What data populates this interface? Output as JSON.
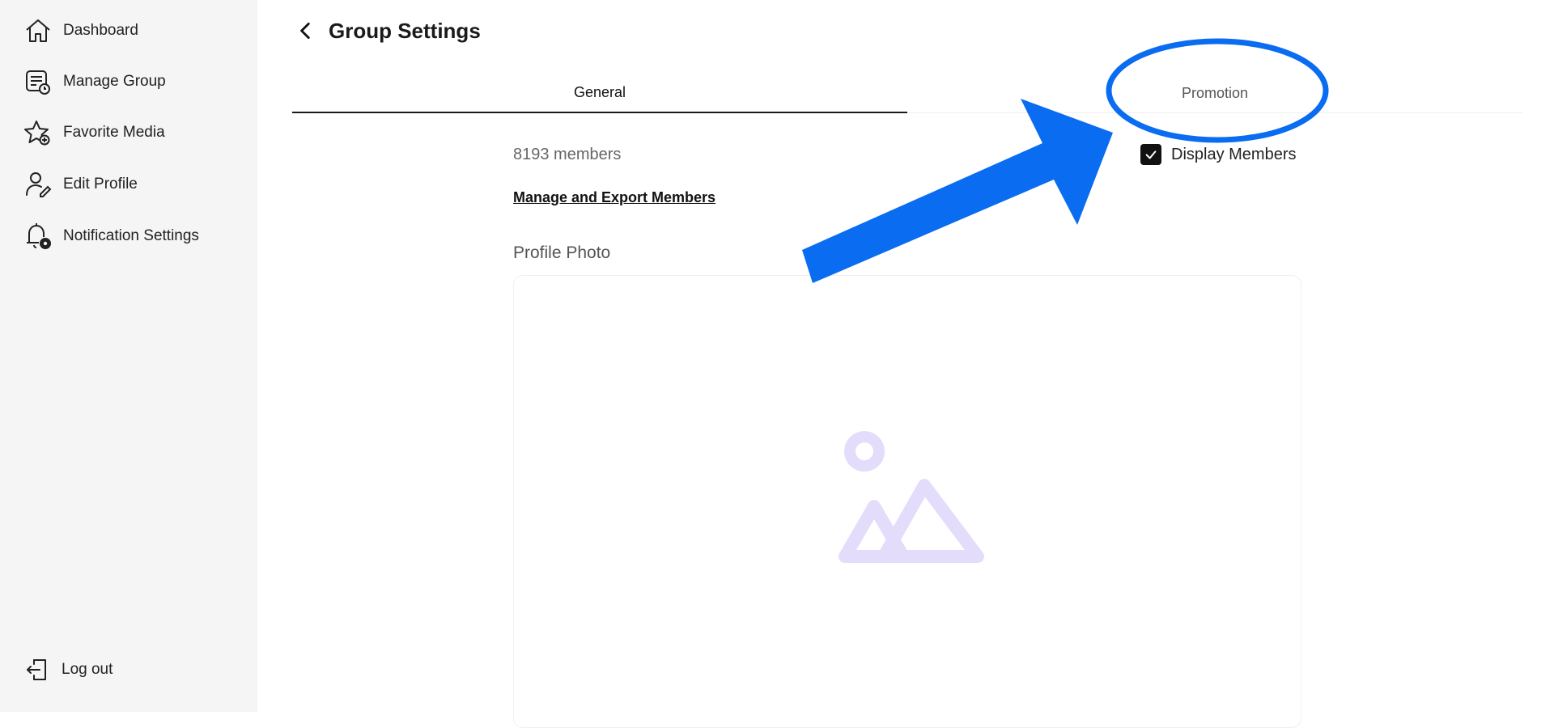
{
  "sidebar": {
    "items": [
      {
        "label": "Dashboard",
        "icon": "home-icon"
      },
      {
        "label": "Manage Group",
        "icon": "manage-group-icon"
      },
      {
        "label": "Favorite Media",
        "icon": "star-add-icon"
      },
      {
        "label": "Edit Profile",
        "icon": "user-edit-icon"
      },
      {
        "label": "Notification Settings",
        "icon": "bell-gear-icon"
      }
    ],
    "logout_label": "Log out"
  },
  "header": {
    "title": "Group Settings"
  },
  "tabs": [
    {
      "label": "General",
      "active": true
    },
    {
      "label": "Promotion",
      "active": false
    }
  ],
  "general": {
    "members_count": "8193 members",
    "display_members_label": "Display Members",
    "display_members_checked": true,
    "manage_link": "Manage and Export Members",
    "profile_photo_label": "Profile Photo"
  },
  "colors": {
    "sidebar_bg": "#f5f5f5",
    "annotation_blue": "#0a6cf0",
    "placeholder_lavender": "#e4dcfb"
  }
}
